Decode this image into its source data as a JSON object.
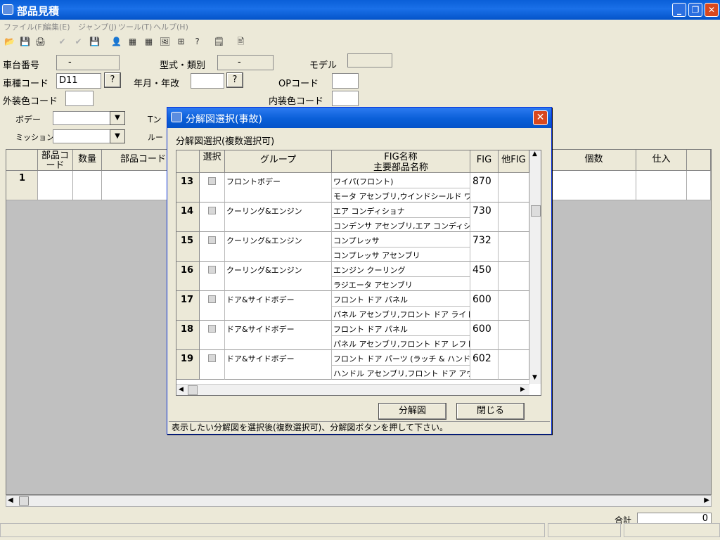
{
  "window": {
    "title": "部品見積",
    "min": "_",
    "restore": "❐",
    "close": "✕"
  },
  "menu": [
    "ファイル(F)",
    "編集(E)",
    "ジャンプ(J)",
    "ツール(T)",
    "ヘルプ(H)"
  ],
  "toolbar": [
    "📂",
    "💾",
    "🖨",
    "✔",
    "✔",
    "💾",
    "👤",
    "▦",
    "▦",
    "🖼",
    "⊞",
    "?",
    "🗒",
    "🖹"
  ],
  "form": {
    "chassis_label": "車台番号",
    "chassis_value": "-",
    "model_type_label": "型式・類別",
    "model_type_value": "-",
    "model_label": "モデル",
    "model_value": "",
    "vehicle_code_label": "車種コード",
    "vehicle_code_value": "D11",
    "q": "?",
    "year_label": "年月・年改",
    "year_value": "",
    "op_label": "OPコード",
    "op_value": "",
    "ext_color_label": "外装色コード",
    "ext_color_value": "",
    "int_color_label": "内装色コード",
    "int_color_value": "",
    "body_label": "ボデー",
    "trans_label": "ミッション",
    "t_label": "Tン",
    "r_label": "ルー"
  },
  "grid": {
    "headers": [
      "部品コード",
      "数量",
      "部品コード",
      "個数",
      "仕入"
    ],
    "row1": "1"
  },
  "status": {
    "total_label": "合計",
    "total_value": "0"
  },
  "dialog": {
    "title": "分解図選択(事故)",
    "subtitle": "分解図選択(複数選択可)",
    "headers": {
      "sel": "選択",
      "group": "グループ",
      "fig_name": "FIG名称",
      "fig_sub": "主要部品名称",
      "fig": "FIG",
      "other": "他FIG"
    },
    "rows": [
      {
        "no": "13",
        "group": "フロントボデー",
        "name": "ワイパ(フロント)",
        "sub": "モータ アセンブリ,ウインドシールド ワイパ",
        "fig": "870"
      },
      {
        "no": "14",
        "group": "クーリング&エンジン",
        "name": "エア コンディショナ",
        "sub": "コンデンサ アセンブリ,エア コンディショナ",
        "fig": "730"
      },
      {
        "no": "15",
        "group": "クーリング&エンジン",
        "name": "コンプレッサ",
        "sub": "コンプレッサ アセンブリ",
        "fig": "732"
      },
      {
        "no": "16",
        "group": "クーリング&エンジン",
        "name": "エンジン クーリング",
        "sub": "ラジエータ アセンブリ",
        "fig": "450"
      },
      {
        "no": "17",
        "group": "ドア&サイドボデー",
        "name": "フロント ドア パネル",
        "sub": "パネル アセンブリ,フロント ドア ライト",
        "fig": "600"
      },
      {
        "no": "18",
        "group": "ドア&サイドボデー",
        "name": "フロント ドア パネル",
        "sub": "パネル アセンブリ,フロント ドア レフト",
        "fig": "600"
      },
      {
        "no": "19",
        "group": "ドア&サイドボデー",
        "name": "フロント ドア パーツ (ラッチ & ハンドル)",
        "sub": "ハンドル アセンブリ,フロント ドア アウタ ラ",
        "fig": "602"
      }
    ],
    "btn_figure": "分解図",
    "btn_close": "閉じる",
    "status": "表示したい分解図を選択後(複数選択可)、分解図ボタンを押して下さい。"
  }
}
